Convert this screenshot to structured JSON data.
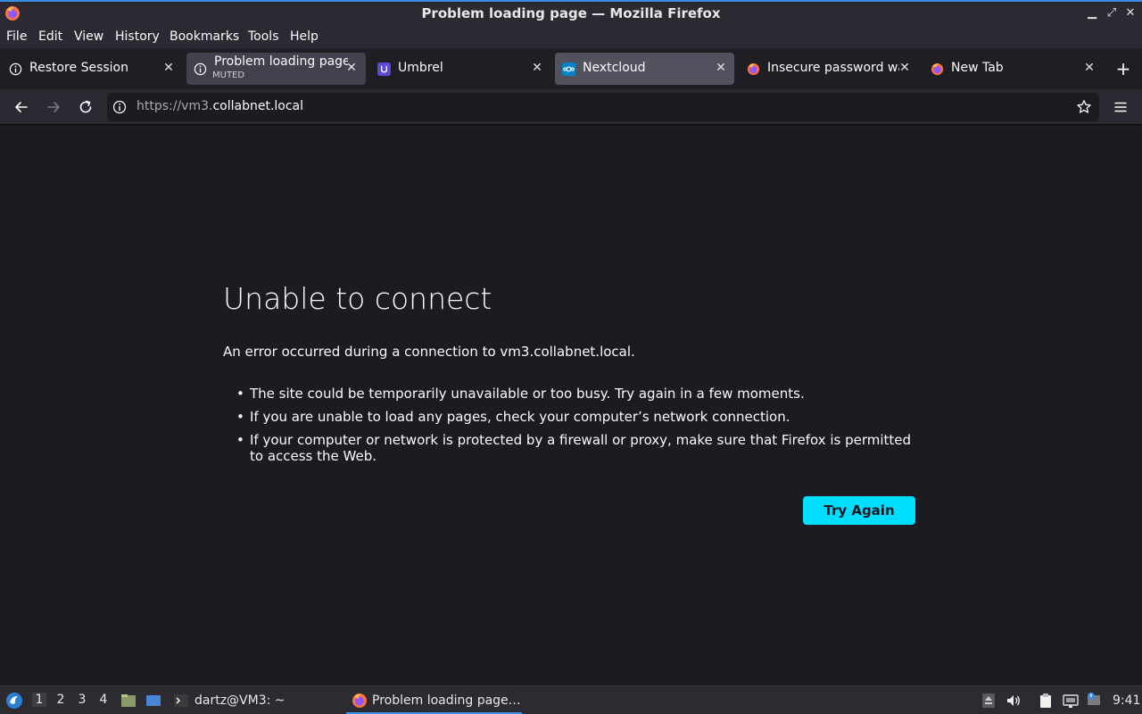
{
  "window": {
    "title": "Problem loading page — Mozilla Firefox"
  },
  "menu": [
    "File",
    "Edit",
    "View",
    "History",
    "Bookmarks",
    "Tools",
    "Help"
  ],
  "tabs": [
    {
      "label": "Restore Session",
      "sub": "",
      "icon": "info-icon"
    },
    {
      "label": "Problem loading page",
      "sub": "MUTED",
      "icon": "info-icon"
    },
    {
      "label": "Umbrel",
      "sub": "",
      "icon": "umbrel-icon"
    },
    {
      "label": "Nextcloud",
      "sub": "",
      "icon": "nextcloud-icon"
    },
    {
      "label": "Insecure password warning",
      "sub": "",
      "icon": "firefox-icon"
    },
    {
      "label": "New Tab",
      "sub": "",
      "icon": "firefox-icon"
    }
  ],
  "urlbar": {
    "prefix": "https://vm3.",
    "domain": "collabnet.local"
  },
  "error": {
    "title": "Unable to connect",
    "description": "An error occurred during a connection to vm3.collabnet.local.",
    "bullets": [
      "The site could be temporarily unavailable or too busy. Try again in a few moments.",
      "If you are unable to load any pages, check your computer’s network connection.",
      "If your computer or network is protected by a firewall or proxy, make sure that Firefox is permitted to access the Web."
    ],
    "button": "Try Again"
  },
  "taskbar": {
    "workspaces": [
      "1",
      "2",
      "3",
      "4"
    ],
    "terminal": "dartz@VM3: ~",
    "active_window": "Problem loading page…",
    "clock": "9:41"
  },
  "colors": {
    "accent": "#00ddff",
    "page_bg": "#1c1b22",
    "toolbar_bg": "#2b2a33"
  }
}
